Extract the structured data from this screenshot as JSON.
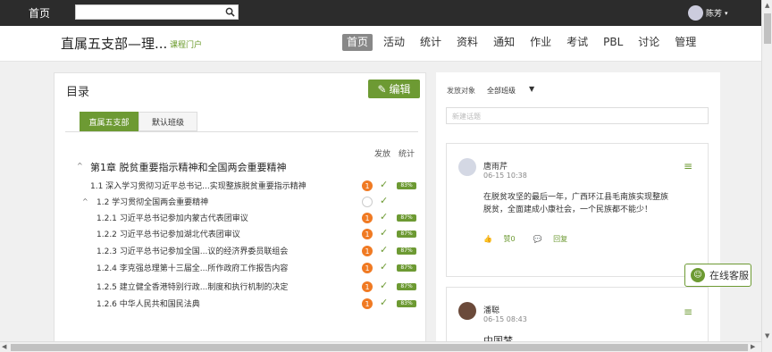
{
  "topbar": {
    "home": "首页",
    "user": "陈芳"
  },
  "header": {
    "title": "直属五支部—理...",
    "portal": "课程门户"
  },
  "nav": [
    "首页",
    "活动",
    "统计",
    "资料",
    "通知",
    "作业",
    "考试",
    "PBL",
    "讨论",
    "管理"
  ],
  "catalog": {
    "heading": "目录",
    "edit": "编辑",
    "tabs": [
      "直属五支部",
      "默认班级"
    ],
    "col_publish": "发放",
    "col_stats": "统计",
    "rows": [
      {
        "label": "第1章 脱贫重要指示精神和全国两会重要精神",
        "type": "chapter"
      },
      {
        "label": "1.1  深入学习贯彻习近平总书记...实现整族脱贫重要指示精神",
        "num": "1",
        "pct": "83%"
      },
      {
        "label": "1.2  学习贯彻全国两会重要精神",
        "num": "",
        "pct": ""
      },
      {
        "label": "1.2.1 习近平总书记参加内蒙古代表团审议",
        "num": "1",
        "pct": "87%"
      },
      {
        "label": "1.2.2 习近平总书记参加湖北代表团审议",
        "num": "1",
        "pct": "87%"
      },
      {
        "label": "1.2.3 习近平总书记参加全国...议的经济界委员联组会",
        "num": "1",
        "pct": "87%"
      },
      {
        "label": "1.2.4 李克强总理第十三届全...所作政府工作报告内容",
        "num": "1",
        "pct": "87%"
      },
      {
        "label": "1.2.5 建立健全香港特别行政...制度和执行机制的决定",
        "num": "1",
        "pct": "87%"
      },
      {
        "label": "1.2.6 中华人民共和国民法典",
        "num": "1",
        "pct": "83%"
      }
    ]
  },
  "discussion": {
    "target_label": "发放对象",
    "class_value": "全部班级",
    "new_topic_placeholder": "新建话题",
    "posts": [
      {
        "name": "唐雨芹",
        "time": "06-15 10:38",
        "body": "在脱贫攻坚的最后一年，广西环江县毛南族实现整族脱贫，全面建成小康社会，一个民族都不能少！",
        "like": "赞0",
        "reply": "回复"
      },
      {
        "name": "潘聪",
        "time": "06-15 08:43",
        "body": "中国梦",
        "like": "",
        "reply": ""
      }
    ]
  },
  "service": "在线客服",
  "colors": {
    "accent": "#6d9a33",
    "badge": "#f07a23"
  }
}
